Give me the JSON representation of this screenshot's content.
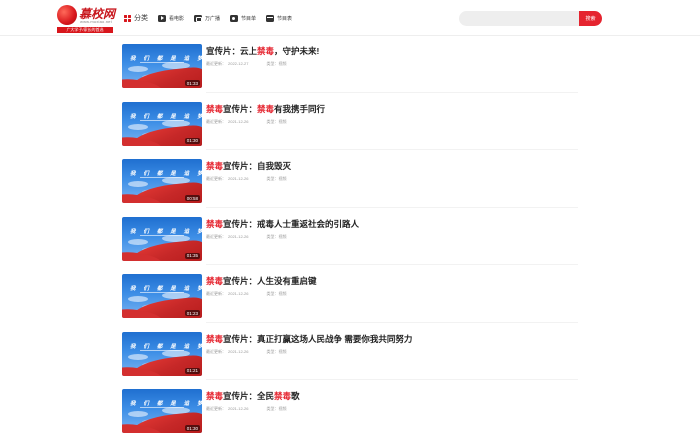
{
  "header": {
    "logo": {
      "name": "慕校网",
      "domain": "www.muxiao.net",
      "slogan": "广大学子/家长的首选"
    },
    "nav": [
      {
        "label": "分类",
        "icon": "category-grid-icon"
      },
      {
        "label": "看电影",
        "icon": "movie-play-icon"
      },
      {
        "label": "万广播",
        "icon": "tv-icon"
      },
      {
        "label": "节目单",
        "icon": "video-icon"
      },
      {
        "label": "节目表",
        "icon": "film-icon"
      }
    ],
    "search": {
      "placeholder": "",
      "button_label": "搜索"
    }
  },
  "list": {
    "date_label": "最近更新：",
    "category_label": "类型：",
    "category_value": "视频",
    "thumb_title": "我 们 都 是 追 梦 人",
    "items": [
      {
        "title_parts": [
          "宣传片：云上",
          "禁毒",
          "，守护未来!"
        ],
        "date": "2022-12-27",
        "duration": "01:33"
      },
      {
        "title_parts": [
          "",
          "禁毒",
          "宣传片：",
          "禁毒",
          "有我携手同行"
        ],
        "date": "2021-12-26",
        "duration": "01:30"
      },
      {
        "title_parts": [
          "",
          "禁毒",
          "宣传片：自我毁灭"
        ],
        "date": "2021-12-26",
        "duration": "00:58"
      },
      {
        "title_parts": [
          "",
          "禁毒",
          "宣传片：戒毒人士重返社会的引路人"
        ],
        "date": "2021-12-26",
        "duration": "01:35"
      },
      {
        "title_parts": [
          "",
          "禁毒",
          "宣传片：人生没有重启键"
        ],
        "date": "2021-12-26",
        "duration": "01:23"
      },
      {
        "title_parts": [
          "",
          "禁毒",
          "宣传片：真正打赢这场人民战争 需要你我共同努力"
        ],
        "date": "2021-12-26",
        "duration": "01:21"
      },
      {
        "title_parts": [
          "",
          "禁毒",
          "宣传片：全民",
          "禁毒",
          "歌"
        ],
        "date": "2021-12-26",
        "duration": "01:30"
      }
    ]
  },
  "colors": {
    "accent": "#e5242f",
    "brand": "#c8161d"
  }
}
